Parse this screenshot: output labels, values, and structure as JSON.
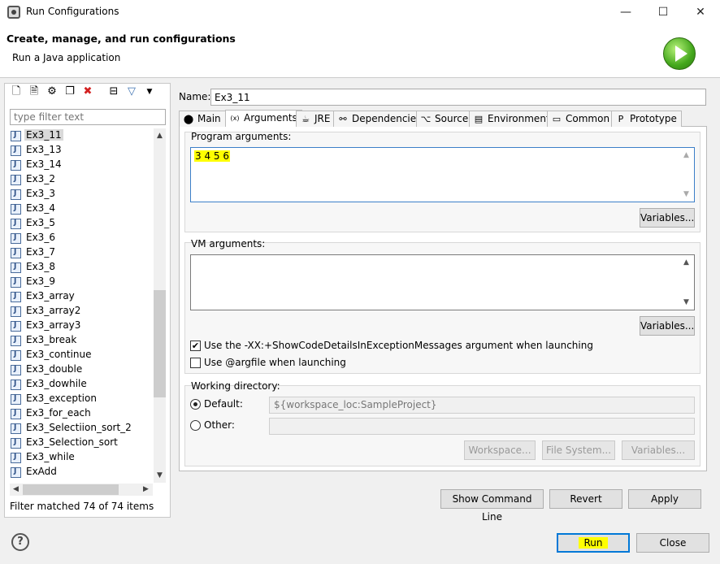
{
  "window": {
    "title": "Run Configurations",
    "controls": {
      "minimize": "—",
      "maximize": "☐",
      "close": "✕"
    }
  },
  "banner": {
    "title": "Create, manage, and run configurations",
    "subtitle": "Run a Java application"
  },
  "left": {
    "filter_placeholder": "type filter text",
    "items": [
      "Ex3_11",
      "Ex3_13",
      "Ex3_14",
      "Ex3_2",
      "Ex3_3",
      "Ex3_4",
      "Ex3_5",
      "Ex3_6",
      "Ex3_7",
      "Ex3_8",
      "Ex3_9",
      "Ex3_array",
      "Ex3_array2",
      "Ex3_array3",
      "Ex3_break",
      "Ex3_continue",
      "Ex3_double",
      "Ex3_dowhile",
      "Ex3_exception",
      "Ex3_for_each",
      "Ex3_Selectiion_sort_2",
      "Ex3_Selection_sort",
      "Ex3_while",
      "ExAdd"
    ],
    "selected_index": 0,
    "status": "Filter matched 74 of 74 items"
  },
  "config": {
    "name_label": "Name:",
    "name_value": "Ex3_11",
    "tabs": [
      {
        "label": "Main",
        "icon": "main-icon"
      },
      {
        "label": "Arguments",
        "icon": "arguments-icon"
      },
      {
        "label": "JRE",
        "icon": "jre-icon"
      },
      {
        "label": "Dependencies",
        "icon": "dependencies-icon"
      },
      {
        "label": "Source",
        "icon": "source-icon"
      },
      {
        "label": "Environment",
        "icon": "environment-icon"
      },
      {
        "label": "Common",
        "icon": "common-icon"
      },
      {
        "label": "Prototype",
        "icon": "prototype-icon"
      }
    ],
    "active_tab": "Arguments",
    "program_args_label": "Program arguments:",
    "program_args_value": "3 4 5 6",
    "variables_label": "Variables...",
    "vm_args_label": "VM arguments:",
    "vm_args_value": "",
    "show_code_details_label": "Use the -XX:+ShowCodeDetailsInExceptionMessages argument when launching",
    "show_code_details_checked": true,
    "argfile_label": "Use @argfile when launching",
    "argfile_checked": false,
    "working_dir_label": "Working directory:",
    "default_label": "Default:",
    "default_value": "${workspace_loc:SampleProject}",
    "other_label": "Other:",
    "other_value": "",
    "workspace_button": "Workspace...",
    "filesystem_button": "File System...",
    "wd_variables_button": "Variables..."
  },
  "actions": {
    "show_command_line": "Show Command Line",
    "revert": "Revert",
    "apply": "Apply",
    "run": "Run",
    "close": "Close",
    "help": "?"
  },
  "colors": {
    "highlight": "#ffff00",
    "focus_border": "#3c7fc8",
    "primary_border": "#0078d7"
  }
}
